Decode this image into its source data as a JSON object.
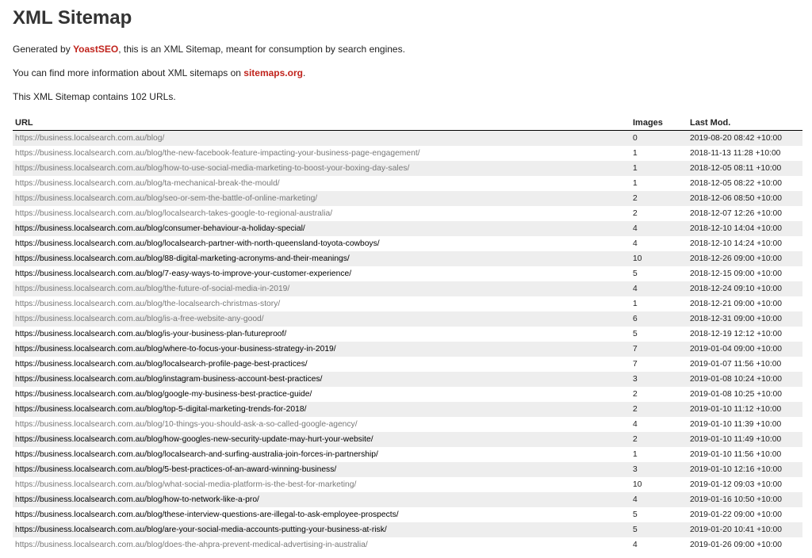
{
  "header": {
    "title": "XML Sitemap"
  },
  "intro": {
    "line1_pre": "Generated by ",
    "line1_link": "YoastSEO",
    "line1_post": ", this is an XML Sitemap, meant for consumption by search engines.",
    "line2_pre": "You can find more information about XML sitemaps on ",
    "line2_link": "sitemaps.org",
    "line2_post": ".",
    "line3": "This XML Sitemap contains 102 URLs."
  },
  "colors": {
    "link_accent": "#c0231c",
    "visited_link": "#777777",
    "row_alt_bg": "#eeeeee"
  },
  "table": {
    "headers": {
      "url": "URL",
      "images": "Images",
      "lastmod": "Last Mod."
    },
    "rows": [
      {
        "url": "https://business.localsearch.com.au/blog/",
        "images": "0",
        "lastmod": "2019-08-20 08:42 +10:00",
        "visited": true
      },
      {
        "url": "https://business.localsearch.com.au/blog/the-new-facebook-feature-impacting-your-business-page-engagement/",
        "images": "1",
        "lastmod": "2018-11-13 11:28 +10:00",
        "visited": true
      },
      {
        "url": "https://business.localsearch.com.au/blog/how-to-use-social-media-marketing-to-boost-your-boxing-day-sales/",
        "images": "1",
        "lastmod": "2018-12-05 08:11 +10:00",
        "visited": true
      },
      {
        "url": "https://business.localsearch.com.au/blog/ta-mechanical-break-the-mould/",
        "images": "1",
        "lastmod": "2018-12-05 08:22 +10:00",
        "visited": true
      },
      {
        "url": "https://business.localsearch.com.au/blog/seo-or-sem-the-battle-of-online-marketing/",
        "images": "2",
        "lastmod": "2018-12-06 08:50 +10:00",
        "visited": true
      },
      {
        "url": "https://business.localsearch.com.au/blog/localsearch-takes-google-to-regional-australia/",
        "images": "2",
        "lastmod": "2018-12-07 12:26 +10:00",
        "visited": true
      },
      {
        "url": "https://business.localsearch.com.au/blog/consumer-behaviour-a-holiday-special/",
        "images": "4",
        "lastmod": "2018-12-10 14:04 +10:00",
        "visited": false
      },
      {
        "url": "https://business.localsearch.com.au/blog/localsearch-partner-with-north-queensland-toyota-cowboys/",
        "images": "4",
        "lastmod": "2018-12-10 14:24 +10:00",
        "visited": false
      },
      {
        "url": "https://business.localsearch.com.au/blog/88-digital-marketing-acronyms-and-their-meanings/",
        "images": "10",
        "lastmod": "2018-12-26 09:00 +10:00",
        "visited": false
      },
      {
        "url": "https://business.localsearch.com.au/blog/7-easy-ways-to-improve-your-customer-experience/",
        "images": "5",
        "lastmod": "2018-12-15 09:00 +10:00",
        "visited": false
      },
      {
        "url": "https://business.localsearch.com.au/blog/the-future-of-social-media-in-2019/",
        "images": "4",
        "lastmod": "2018-12-24 09:10 +10:00",
        "visited": true
      },
      {
        "url": "https://business.localsearch.com.au/blog/the-localsearch-christmas-story/",
        "images": "1",
        "lastmod": "2018-12-21 09:00 +10:00",
        "visited": true
      },
      {
        "url": "https://business.localsearch.com.au/blog/is-a-free-website-any-good/",
        "images": "6",
        "lastmod": "2018-12-31 09:00 +10:00",
        "visited": true
      },
      {
        "url": "https://business.localsearch.com.au/blog/is-your-business-plan-futureproof/",
        "images": "5",
        "lastmod": "2018-12-19 12:12 +10:00",
        "visited": false
      },
      {
        "url": "https://business.localsearch.com.au/blog/where-to-focus-your-business-strategy-in-2019/",
        "images": "7",
        "lastmod": "2019-01-04 09:00 +10:00",
        "visited": false
      },
      {
        "url": "https://business.localsearch.com.au/blog/localsearch-profile-page-best-practices/",
        "images": "7",
        "lastmod": "2019-01-07 11:56 +10:00",
        "visited": false
      },
      {
        "url": "https://business.localsearch.com.au/blog/instagram-business-account-best-practices/",
        "images": "3",
        "lastmod": "2019-01-08 10:24 +10:00",
        "visited": false
      },
      {
        "url": "https://business.localsearch.com.au/blog/google-my-business-best-practice-guide/",
        "images": "2",
        "lastmod": "2019-01-08 10:25 +10:00",
        "visited": false
      },
      {
        "url": "https://business.localsearch.com.au/blog/top-5-digital-marketing-trends-for-2018/",
        "images": "2",
        "lastmod": "2019-01-10 11:12 +10:00",
        "visited": false
      },
      {
        "url": "https://business.localsearch.com.au/blog/10-things-you-should-ask-a-so-called-google-agency/",
        "images": "4",
        "lastmod": "2019-01-10 11:39 +10:00",
        "visited": true
      },
      {
        "url": "https://business.localsearch.com.au/blog/how-googles-new-security-update-may-hurt-your-website/",
        "images": "2",
        "lastmod": "2019-01-10 11:49 +10:00",
        "visited": false
      },
      {
        "url": "https://business.localsearch.com.au/blog/localsearch-and-surfing-australia-join-forces-in-partnership/",
        "images": "1",
        "lastmod": "2019-01-10 11:56 +10:00",
        "visited": false
      },
      {
        "url": "https://business.localsearch.com.au/blog/5-best-practices-of-an-award-winning-business/",
        "images": "3",
        "lastmod": "2019-01-10 12:16 +10:00",
        "visited": false
      },
      {
        "url": "https://business.localsearch.com.au/blog/what-social-media-platform-is-the-best-for-marketing/",
        "images": "10",
        "lastmod": "2019-01-12 09:03 +10:00",
        "visited": true
      },
      {
        "url": "https://business.localsearch.com.au/blog/how-to-network-like-a-pro/",
        "images": "4",
        "lastmod": "2019-01-16 10:50 +10:00",
        "visited": false
      },
      {
        "url": "https://business.localsearch.com.au/blog/these-interview-questions-are-illegal-to-ask-employee-prospects/",
        "images": "5",
        "lastmod": "2019-01-22 09:00 +10:00",
        "visited": false
      },
      {
        "url": "https://business.localsearch.com.au/blog/are-your-social-media-accounts-putting-your-business-at-risk/",
        "images": "5",
        "lastmod": "2019-01-20 10:41 +10:00",
        "visited": false
      },
      {
        "url": "https://business.localsearch.com.au/blog/does-the-ahpra-prevent-medical-advertising-in-australia/",
        "images": "4",
        "lastmod": "2019-01-26 09:00 +10:00",
        "visited": true
      }
    ]
  }
}
